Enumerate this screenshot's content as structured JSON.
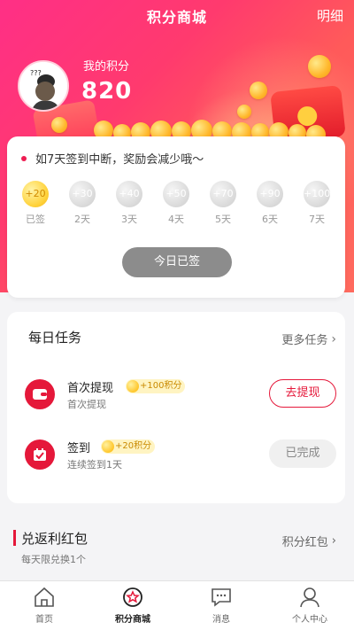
{
  "header": {
    "title": "积分商城",
    "detail_link": "明细"
  },
  "profile": {
    "avatar_text": "???",
    "points_label": "我的积分",
    "points_value": "820"
  },
  "signin": {
    "notice": "如7天签到中断，奖励会减少哦～",
    "days": [
      {
        "reward": "+20",
        "label": "已签",
        "done": true
      },
      {
        "reward": "+30",
        "label": "2天",
        "done": false
      },
      {
        "reward": "+40",
        "label": "3天",
        "done": false
      },
      {
        "reward": "+50",
        "label": "4天",
        "done": false
      },
      {
        "reward": "+70",
        "label": "5天",
        "done": false
      },
      {
        "reward": "+90",
        "label": "6天",
        "done": false
      },
      {
        "reward": "+100",
        "label": "7天",
        "done": false
      }
    ],
    "button_label": "今日已签"
  },
  "tasks": {
    "title": "每日任务",
    "more_label": "更多任务",
    "items": [
      {
        "name": "首次提现",
        "badge": "+100积分",
        "subtitle": "首次提现",
        "button": "去提现",
        "status": "pending"
      },
      {
        "name": "签到",
        "badge": "+20积分",
        "subtitle": "连续签到1天",
        "button": "已完成",
        "status": "done"
      }
    ]
  },
  "redpacket": {
    "title": "兑返利红包",
    "subtitle": "每天限兑换1个",
    "more_label": "积分红包"
  },
  "tabbar": {
    "items": [
      {
        "label": "首页",
        "icon": "home-icon"
      },
      {
        "label": "积分商城",
        "icon": "star-shop-icon",
        "active": true
      },
      {
        "label": "消息",
        "icon": "message-icon"
      },
      {
        "label": "个人中心",
        "icon": "user-icon"
      }
    ]
  },
  "colors": {
    "primary_red": "#e5183a",
    "hero_pink": "#ff2f86",
    "coin_gold": "#ffc62a"
  }
}
